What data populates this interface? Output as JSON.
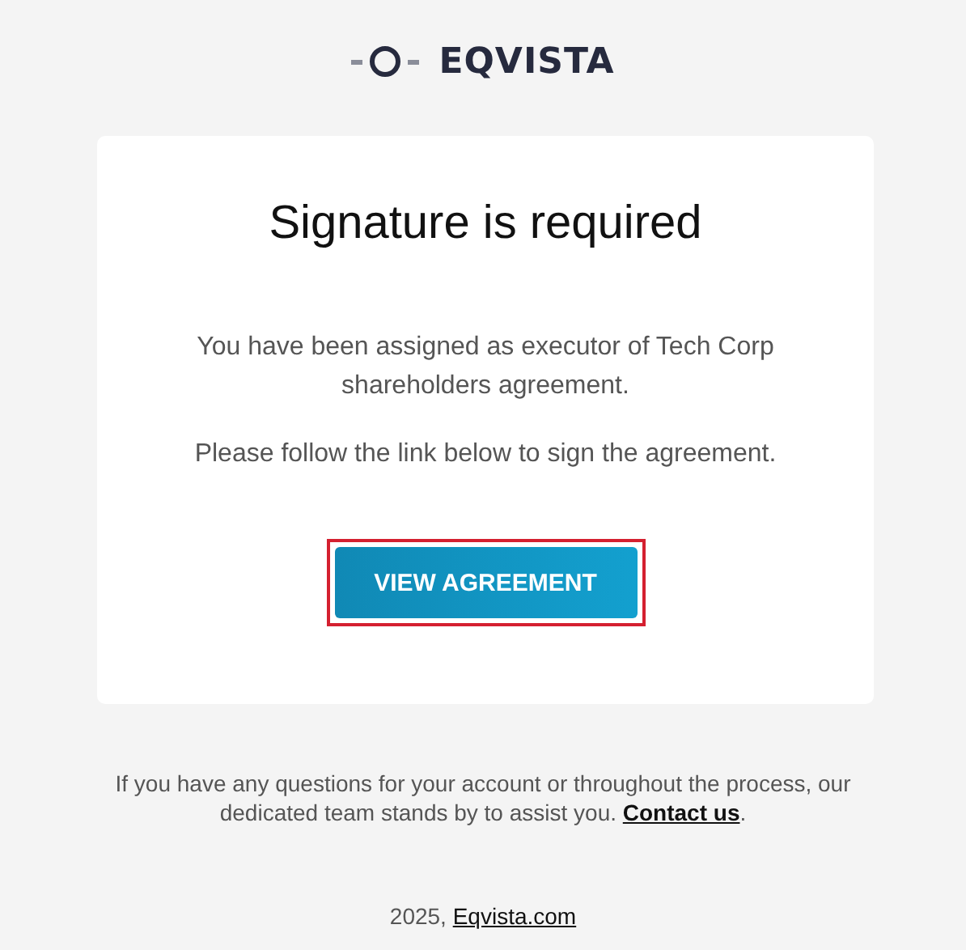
{
  "logo": {
    "text": "EQVISTA"
  },
  "card": {
    "title": "Signature is required",
    "paragraphs": [
      "You have been assigned as executor of Tech Corp shareholders agreement.",
      "Please follow the link below to sign the agreement."
    ],
    "button": {
      "label": "VIEW AGREEMENT",
      "highlighted": true
    }
  },
  "footer": {
    "text": "If you have any questions for your account or throughout the process, our dedicated team stands by to assist you.",
    "link": "Contact us",
    "after": "."
  },
  "copyright": {
    "text": "2025,",
    "link": "Eqvista.com"
  }
}
